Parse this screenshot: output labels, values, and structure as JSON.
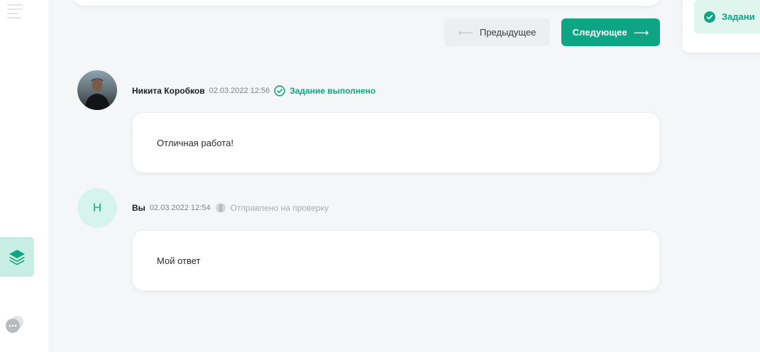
{
  "sidebar": {
    "menu_icon": "hamburger-menu-icon",
    "layers_icon": "layers-icon",
    "chat_icon": "chat-bubble-icon",
    "accent_bg": "#c8eee3",
    "accent": "#0ea584"
  },
  "pager": {
    "prev_label": "Предыдущее",
    "prev_icon": "arrow-left-icon",
    "next_label": "Следующее",
    "next_icon": "arrow-right-icon",
    "next_bg": "#0ea584"
  },
  "right_panel": {
    "status_label": "Задани",
    "status_icon": "check-circle-icon"
  },
  "comments": [
    {
      "author": "Никита Коробков",
      "date": "02.03.2022 12:56",
      "status": "Задание выполнено",
      "status_icon": "check-circle-outline-icon",
      "avatar": "photo",
      "text": "Отличная работа!"
    },
    {
      "author": "Вы",
      "avatar_letter": "Н",
      "date": "02.03.2022 12:54",
      "status": "Отправлено на проверку",
      "status_icon": "hourglass-icon",
      "text": "Мой ответ"
    }
  ]
}
